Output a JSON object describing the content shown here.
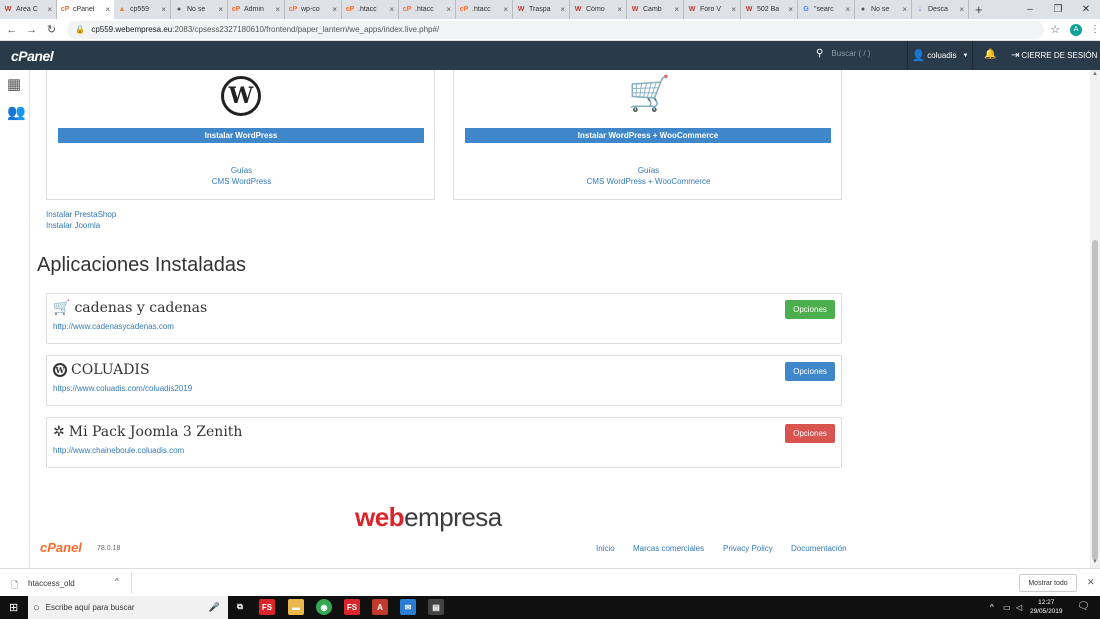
{
  "browser": {
    "tabs": [
      {
        "label": "Área C",
        "favicon": "W",
        "favcolor": "#c0392b"
      },
      {
        "label": "cPanel",
        "favicon": "cP",
        "favcolor": "#ff6c2c",
        "active": true
      },
      {
        "label": "cp559",
        "favicon": "▲",
        "favcolor": "#e67e22"
      },
      {
        "label": "No se",
        "favicon": "●",
        "favcolor": "#555555"
      },
      {
        "label": "Admin",
        "favicon": "cP",
        "favcolor": "#ff6c2c"
      },
      {
        "label": "wp-co",
        "favicon": "cP",
        "favcolor": "#ff6c2c"
      },
      {
        "label": ".htacc",
        "favicon": "cP",
        "favcolor": "#ff6c2c"
      },
      {
        "label": ".htacc",
        "favicon": "cP",
        "favcolor": "#ff6c2c"
      },
      {
        "label": ".htacc",
        "favicon": "cP",
        "favcolor": "#ff6c2c"
      },
      {
        "label": "Traspa",
        "favicon": "W",
        "favcolor": "#c0392b"
      },
      {
        "label": "Cómo",
        "favicon": "W",
        "favcolor": "#c0392b"
      },
      {
        "label": "Camb",
        "favicon": "W",
        "favcolor": "#c0392b"
      },
      {
        "label": "Foro V",
        "favicon": "W",
        "favcolor": "#c0392b"
      },
      {
        "label": "502 Ba",
        "favicon": "W",
        "favcolor": "#c0392b"
      },
      {
        "label": "\"searc",
        "favicon": "G",
        "favcolor": "#4285f4"
      },
      {
        "label": "No se",
        "favicon": "●",
        "favcolor": "#555555"
      },
      {
        "label": "Desca",
        "favicon": "↓",
        "favcolor": "#1a73e8"
      }
    ],
    "url_host": "cp559.webempresa.eu",
    "url_path": ":2083/cpsess2327180610/frontend/paper_lantern/we_apps/index.live.php#/",
    "profile_initial": "A"
  },
  "cpanel": {
    "logo": "cPanel",
    "search_placeholder": "Buscar ( / )",
    "username": "coluadis",
    "logout_label": "CIERRE DE SESIÓN"
  },
  "installers": [
    {
      "button": "Instalar WordPress",
      "guides": "Guías",
      "cms_link": "CMS WordPress",
      "icon": "wordpress-logo-icon"
    },
    {
      "button": "Instalar WordPress + WooCommerce",
      "guides": "Guías",
      "cms_link": "CMS WordPress + WooCommerce",
      "icon": "shopping-cart-icon"
    }
  ],
  "extra_links": [
    "Instalar PrestaShop",
    "Instalar Joomla"
  ],
  "installed_title": "Aplicaciones Instaladas",
  "apps": [
    {
      "name": "cadenas y cadenas",
      "url": "http://www.cadenasycadenas.com",
      "button": "Opciones",
      "button_color": "#4cae4c",
      "icon": "shopping-cart-icon"
    },
    {
      "name": "COLUADIS",
      "url": "https://www.coluadis.com/coluadis2019",
      "button": "Opciones",
      "button_color": "#3f87c8",
      "icon": "wordpress-icon"
    },
    {
      "name": "Mi Pack Joomla 3 Zenith",
      "url": "http://www.chaineboule.coluadis.com",
      "button": "Opciones",
      "button_color": "#d9534f",
      "icon": "joomla-icon"
    }
  ],
  "brand": {
    "part1": "web",
    "part2": "empresa"
  },
  "footer": {
    "logo": "cPanel",
    "version": "78.0.18",
    "links": [
      "Inicio",
      "Marcas comerciales",
      "Privacy Policy",
      "Documentación"
    ]
  },
  "download_bar": {
    "filename": "htaccess_old",
    "show_all": "Mostrar todo"
  },
  "taskbar": {
    "search_placeholder": "Escribe aquí para buscar",
    "time": "12:27",
    "date": "29/05/2019"
  }
}
